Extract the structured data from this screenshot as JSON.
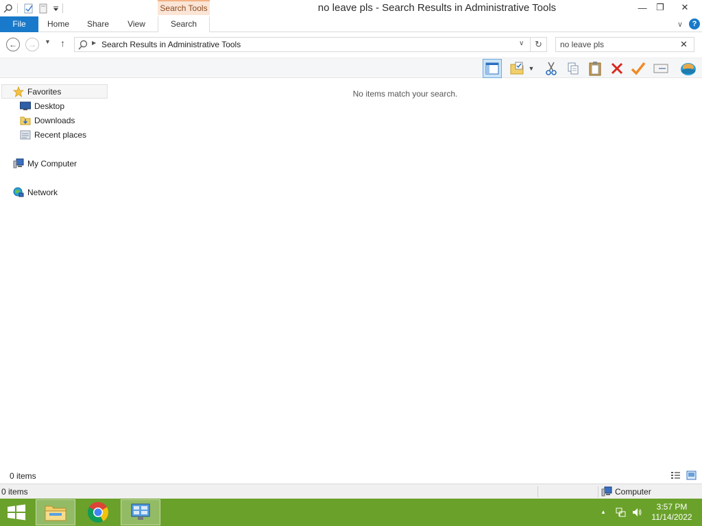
{
  "window": {
    "title": "no leave pls - Search Results in Administrative Tools",
    "context_tab_header": "Search Tools",
    "controls": {
      "minimize": "—",
      "restore": "❐",
      "close": "✕"
    }
  },
  "ribbon": {
    "tabs": [
      {
        "label": "File"
      },
      {
        "label": "Home"
      },
      {
        "label": "Share"
      },
      {
        "label": "View"
      },
      {
        "label": "Search"
      }
    ],
    "help_label": "?",
    "collapse_glyph": "∨"
  },
  "address": {
    "back_glyph": "←",
    "forward_glyph": "→",
    "recent_glyph": "▼",
    "up_glyph": "↑",
    "breadcrumb_separator": "▶",
    "path_text": "Search Results in Administrative Tools",
    "dropdown_glyph": "∨",
    "refresh_glyph": "↻"
  },
  "search": {
    "value": "no leave pls",
    "clear_glyph": "✕"
  },
  "toolbar": {
    "icons": [
      "navigation-pane-icon",
      "folder-check-icon",
      "cut-icon",
      "copy-icon",
      "paste-icon",
      "delete-icon",
      "check-icon",
      "properties-icon",
      "globe-icon"
    ],
    "dropdown_glyph": "▼"
  },
  "navigation_pane": {
    "favorites": "Favorites",
    "favorite_items": [
      {
        "label": "Desktop",
        "icon": "desktop-icon"
      },
      {
        "label": "Downloads",
        "icon": "downloads-folder-icon"
      },
      {
        "label": "Recent places",
        "icon": "recent-places-icon"
      }
    ],
    "computer": "My Computer",
    "network": "Network"
  },
  "content": {
    "empty_message": "No items match your search."
  },
  "statusbar": {
    "item_count": "0 items",
    "item_count_lower": "0 items",
    "zone": "Computer"
  },
  "taskbar": {
    "apps": [
      "file-explorer-icon",
      "chrome-icon",
      "control-panel-icon"
    ],
    "tray_expand_glyph": "▲",
    "time": "3:57 PM",
    "date": "11/14/2022"
  },
  "colors": {
    "file_tab": "#1979ca",
    "context_tab": "#fbe5d6",
    "taskbar": "#6aa12a"
  }
}
